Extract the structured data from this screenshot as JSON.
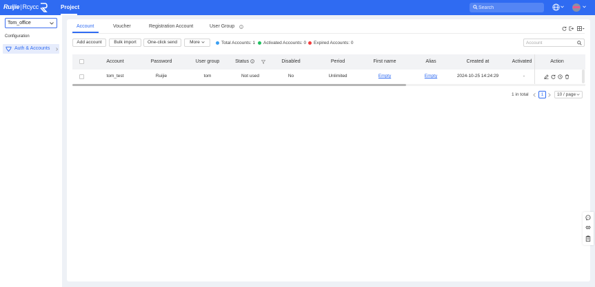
{
  "header": {
    "brand_a": "Ruijie",
    "brand_sep": "|",
    "brand_b": "Rcycc",
    "nav_project": "Project",
    "search_placeholder": "Search",
    "accent_color": "#2f6bf2"
  },
  "sidebar": {
    "project_select_value": "Tom_office",
    "section_label": "Configuration",
    "active_item_label": "Auth & Accounts"
  },
  "tabs": [
    {
      "label": "Account",
      "active": true
    },
    {
      "label": "Voucher",
      "active": false
    },
    {
      "label": "Registration Account",
      "active": false
    },
    {
      "label": "User Group",
      "active": false
    }
  ],
  "toolbar": {
    "add_account": "Add account",
    "bulk_import": "Bulk import",
    "one_click_send": "One-click send",
    "more": "More",
    "search_placeholder": "Account"
  },
  "stats": {
    "total": "Total Accounts: 1",
    "activated": "Activated Accounts: 0",
    "expired": "Expired Accounts: 0",
    "colors": {
      "total": "#3b9ff2",
      "activated": "#1fbf5f",
      "expired": "#f23d3d"
    }
  },
  "table": {
    "columns": [
      "Account",
      "Password",
      "User group",
      "Status",
      "Disabled",
      "Period",
      "First name",
      "Alias",
      "Created at",
      "Activated",
      "Action"
    ],
    "rows": [
      {
        "account": "tom_test",
        "password": "Ruijie",
        "user_group": "tom",
        "status": "Not used",
        "disabled": "No",
        "period": "Unlimited",
        "first_name": "Empty",
        "alias": "Empty",
        "created_at": "2024-10-25 14:24:29",
        "activated": "-"
      }
    ]
  },
  "pagination": {
    "total_text": "1 in total",
    "current_page": "1",
    "page_size": "10 / page"
  },
  "icons": [
    "search-icon",
    "globe-icon",
    "info-icon",
    "refresh-icon",
    "export-icon",
    "column-settings-icon",
    "filter-icon",
    "edit-icon",
    "reset-icon",
    "clock-icon",
    "trash-icon",
    "chat-icon",
    "handshake-icon",
    "clipboard-icon"
  ]
}
